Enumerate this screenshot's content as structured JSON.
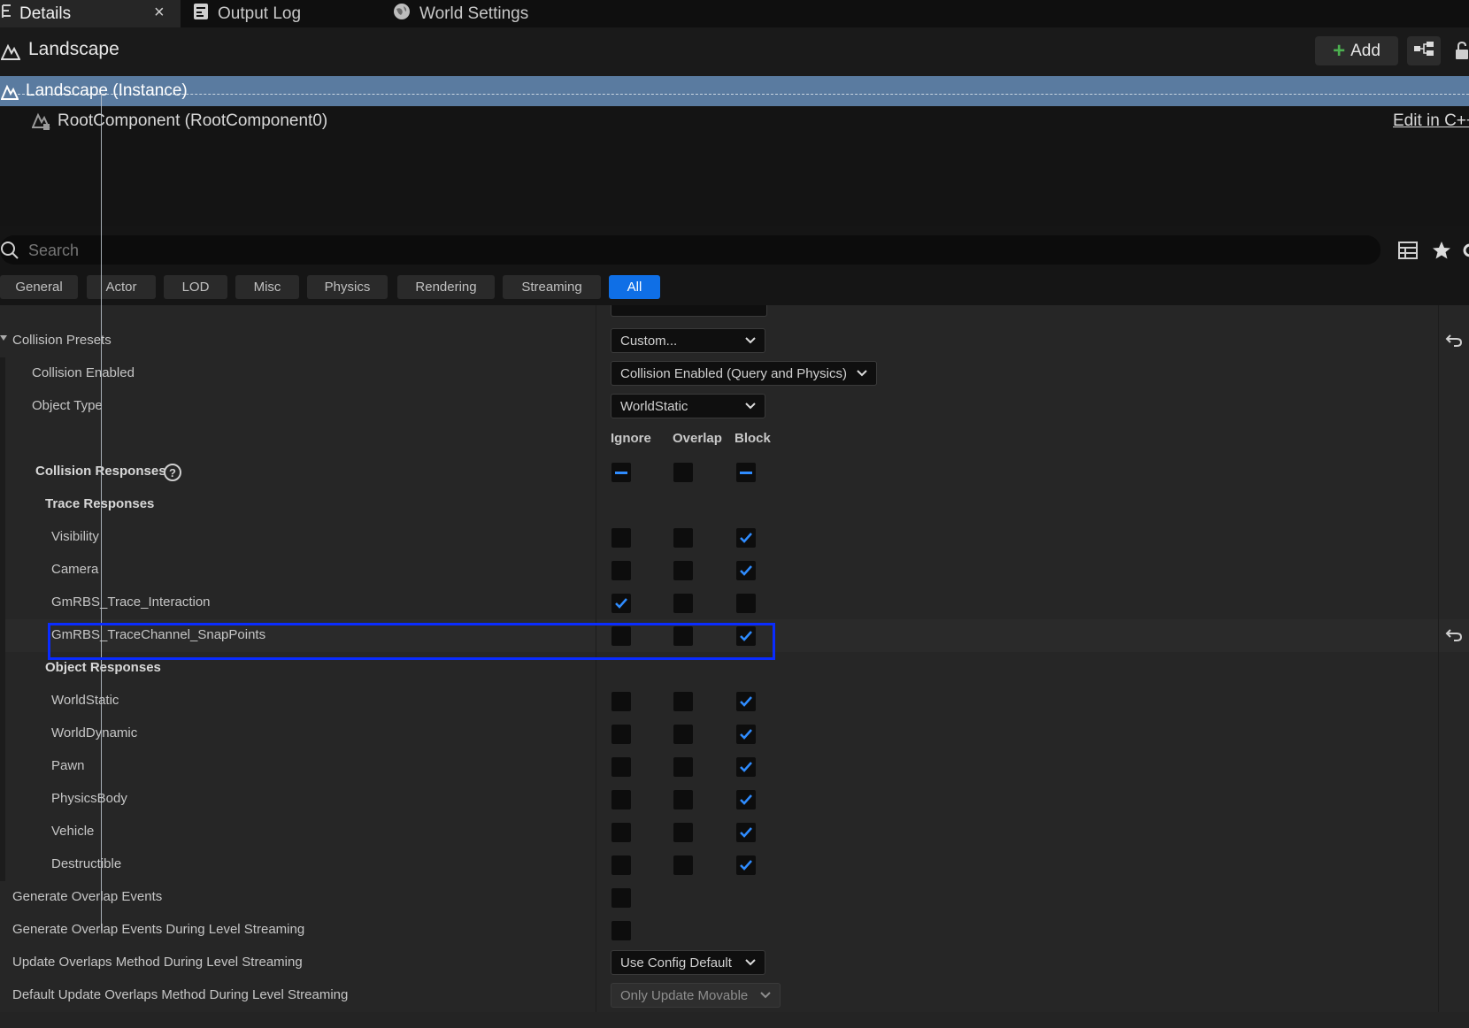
{
  "tabs": [
    {
      "label": "Details",
      "active": true,
      "icon": "details-icon"
    },
    {
      "label": "Output Log",
      "icon": "output-log-icon"
    },
    {
      "label": "World Settings",
      "icon": "world-icon"
    }
  ],
  "tab_close": "×",
  "actor": {
    "title": "Landscape",
    "add_label": "Add"
  },
  "components": {
    "selected": "Landscape (Instance)",
    "root": "RootComponent (RootComponent0)",
    "edit_link": "Edit in C++"
  },
  "search": {
    "placeholder": "Search"
  },
  "filters": [
    "General",
    "Actor",
    "LOD",
    "Misc",
    "Physics",
    "Rendering",
    "Streaming",
    "All"
  ],
  "active_filter": "All",
  "properties": {
    "collision_presets": {
      "label": "Collision Presets",
      "value": "Custom..."
    },
    "collision_enabled": {
      "label": "Collision Enabled",
      "value": "Collision Enabled (Query and Physics)"
    },
    "object_type": {
      "label": "Object Type",
      "value": "WorldStatic"
    },
    "columns": {
      "ignore": "Ignore",
      "overlap": "Overlap",
      "block": "Block"
    },
    "collision_responses": "Collision Responses",
    "trace_responses": "Trace Responses",
    "object_responses": "Object Responses",
    "trace_channels": [
      {
        "label": "Visibility",
        "state": "block"
      },
      {
        "label": "Camera",
        "state": "block"
      },
      {
        "label": "GmRBS_Trace_Interaction",
        "state": "ignore"
      },
      {
        "label": "GmRBS_TraceChannel_SnapPoints",
        "state": "block"
      }
    ],
    "object_channels": [
      {
        "label": "WorldStatic",
        "state": "block"
      },
      {
        "label": "WorldDynamic",
        "state": "block"
      },
      {
        "label": "Pawn",
        "state": "block"
      },
      {
        "label": "PhysicsBody",
        "state": "block"
      },
      {
        "label": "Vehicle",
        "state": "block"
      },
      {
        "label": "Destructible",
        "state": "block"
      }
    ],
    "generate_overlap_events": "Generate Overlap Events",
    "generate_overlap_streaming": "Generate Overlap Events During Level Streaming",
    "update_overlaps_method": {
      "label": "Update Overlaps Method During Level Streaming",
      "value": "Use Config Default"
    },
    "default_update_overlaps": {
      "label": "Default Update Overlaps Method During Level Streaming",
      "value": "Only Update Movable"
    }
  },
  "colors": {
    "accent": "#0f6fe6",
    "highlight_box": "#0a2cff",
    "check": "#2f8cff"
  }
}
